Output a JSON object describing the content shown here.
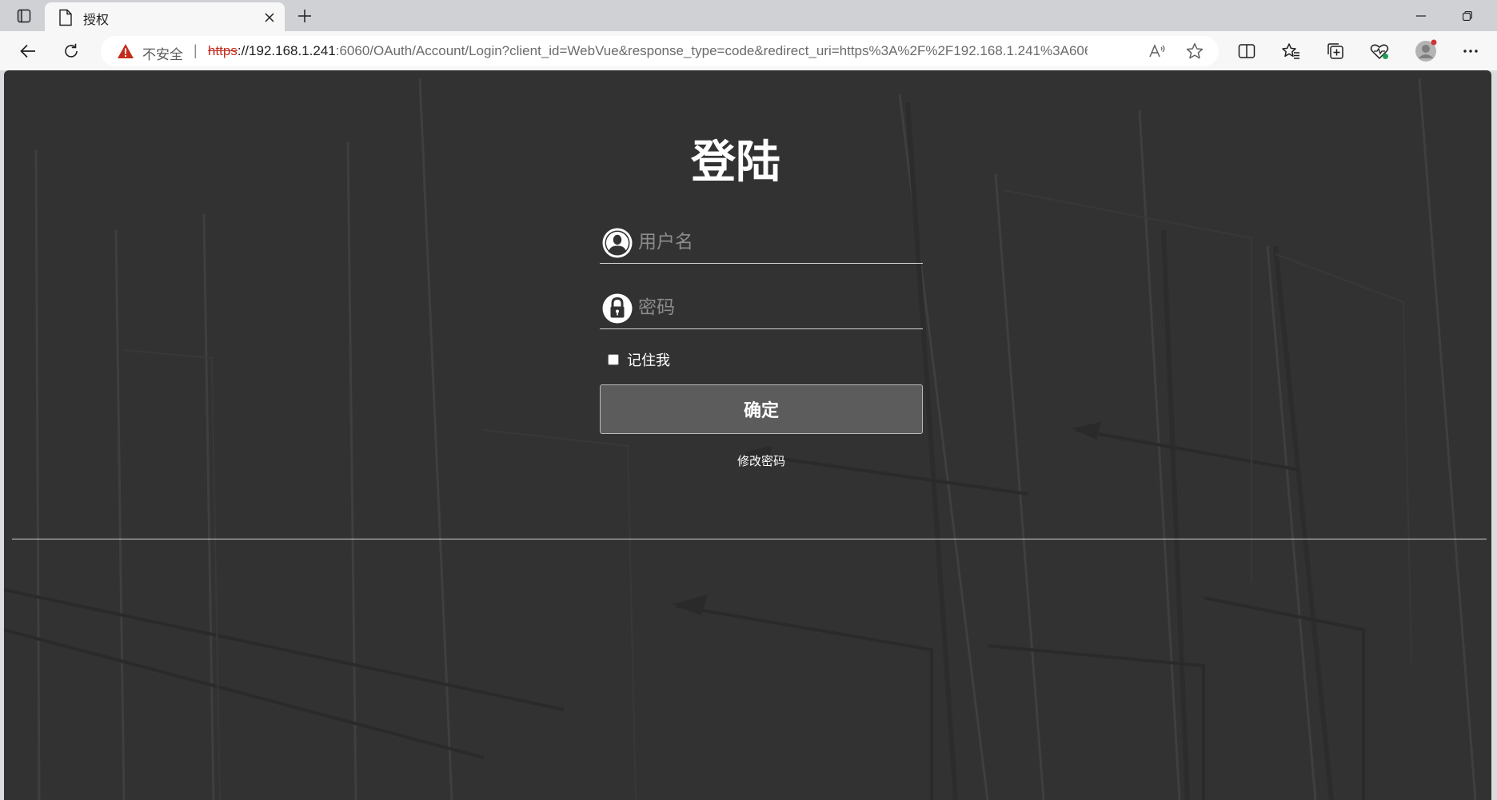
{
  "tab": {
    "title": "授权"
  },
  "address_bar": {
    "insecure_label": "不安全",
    "separator": "|",
    "url_scheme": "https",
    "url_host": "://192.168.1.241",
    "url_rest": ":6060/OAuth/Account/Login?client_id=WebVue&response_type=code&redirect_uri=https%3A%2F%2F192.168.1.241%3A6060..."
  },
  "login": {
    "title": "登陆",
    "username_placeholder": "用户名",
    "password_placeholder": "密码",
    "remember_label": "记住我",
    "submit_label": "确定",
    "change_password_label": "修改密码"
  },
  "colors": {
    "page_background": "#323232",
    "button_background": "#5c5c5c",
    "warning": "#c42b1c"
  },
  "icons": {
    "username_field": "user-icon",
    "password_field": "lock-icon",
    "security_warning": "warning-icon"
  }
}
